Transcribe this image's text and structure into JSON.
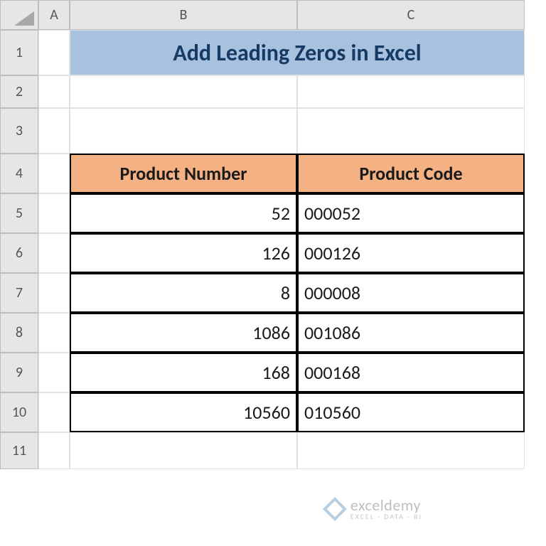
{
  "columns": {
    "a": "A",
    "b": "B",
    "c": "C"
  },
  "rows": [
    "1",
    "2",
    "3",
    "4",
    "5",
    "6",
    "7",
    "8",
    "9",
    "10",
    "11"
  ],
  "title": "Add Leading Zeros in Excel",
  "table": {
    "headers": {
      "b": "Product Number",
      "c": "Product Code"
    },
    "data": [
      {
        "num": "52",
        "code": "000052"
      },
      {
        "num": "126",
        "code": "000126"
      },
      {
        "num": "8",
        "code": "000008"
      },
      {
        "num": "1086",
        "code": "001086"
      },
      {
        "num": "168",
        "code": "000168"
      },
      {
        "num": "10560",
        "code": "010560"
      }
    ]
  },
  "watermark": {
    "main": "exceldemy",
    "sub": "EXCEL · DATA · BI"
  }
}
